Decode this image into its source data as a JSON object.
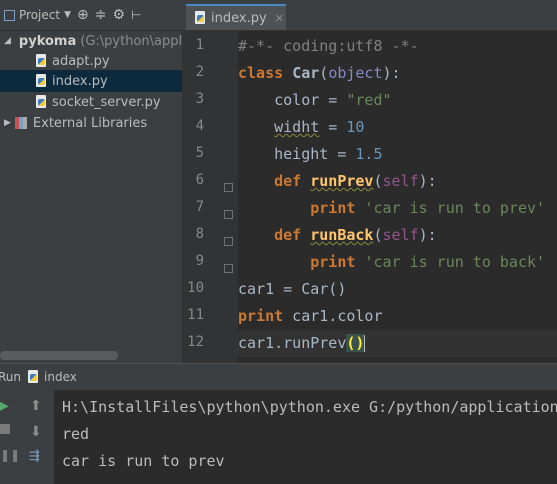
{
  "project_panel": {
    "title": "Project",
    "tree": [
      {
        "label": "pykoma",
        "path": "(G:\\python\\applic"
      },
      {
        "label": "adapt.py"
      },
      {
        "label": "index.py"
      },
      {
        "label": "socket_server.py"
      },
      {
        "label": "External Libraries"
      }
    ]
  },
  "editor": {
    "tab_label": "index.py",
    "line_numbers": [
      "1",
      "2",
      "3",
      "4",
      "5",
      "6",
      "7",
      "8",
      "9",
      "10",
      "11",
      "12"
    ]
  },
  "run_panel": {
    "title": "Run",
    "config": "index",
    "output": [
      "H:\\InstallFiles\\python\\python.exe G:/python/application",
      "red",
      "car is run to prev"
    ]
  },
  "colors": {
    "keyword": "#cc7832",
    "string": "#6a8759",
    "number": "#6897bb",
    "function": "#ffc66d",
    "comment": "#808080",
    "self": "#94558d"
  }
}
